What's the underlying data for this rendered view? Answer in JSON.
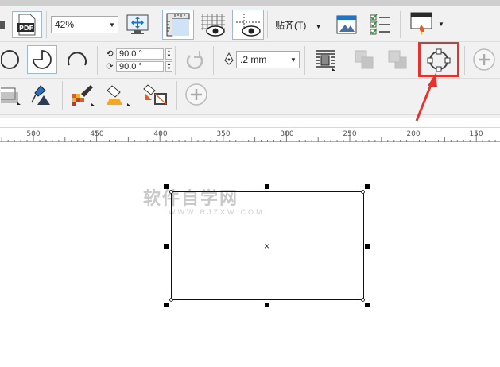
{
  "toolbar": {
    "zoom_value": "42%",
    "snap_label": "贴齐(T)",
    "angle_start": "90.0 °",
    "angle_end": "90.0 °",
    "outline_width": ".2 mm"
  },
  "ruler": {
    "labels": [
      "500",
      "450",
      "400",
      "350",
      "300",
      "250",
      "200",
      "150"
    ]
  },
  "watermark": {
    "title": "软件自学网",
    "url": "WWW.RJZXW.COM"
  },
  "colors": {
    "toolbar_bg": "#f1f1f1",
    "highlight": "#e8302c",
    "arrow": "#e8302c",
    "accent_blue": "#1f74c9"
  },
  "icons": [
    "pdf-icon",
    "pan-view-icon",
    "rulers-icon",
    "grid-view-icon",
    "guidelines-icon",
    "options-icon",
    "checklist-icon",
    "launcher-icon",
    "ellipse-icon",
    "pie-icon",
    "arc-icon",
    "rotate-icon",
    "pen-icon",
    "wrap-text-icon",
    "to-front-icon",
    "to-back-icon",
    "convert-to-curves-icon",
    "add-icon",
    "shadow-icon",
    "fill-picker-icon",
    "fill-drop-icon",
    "interactive-fill-icon",
    "copy-fill-icon"
  ]
}
